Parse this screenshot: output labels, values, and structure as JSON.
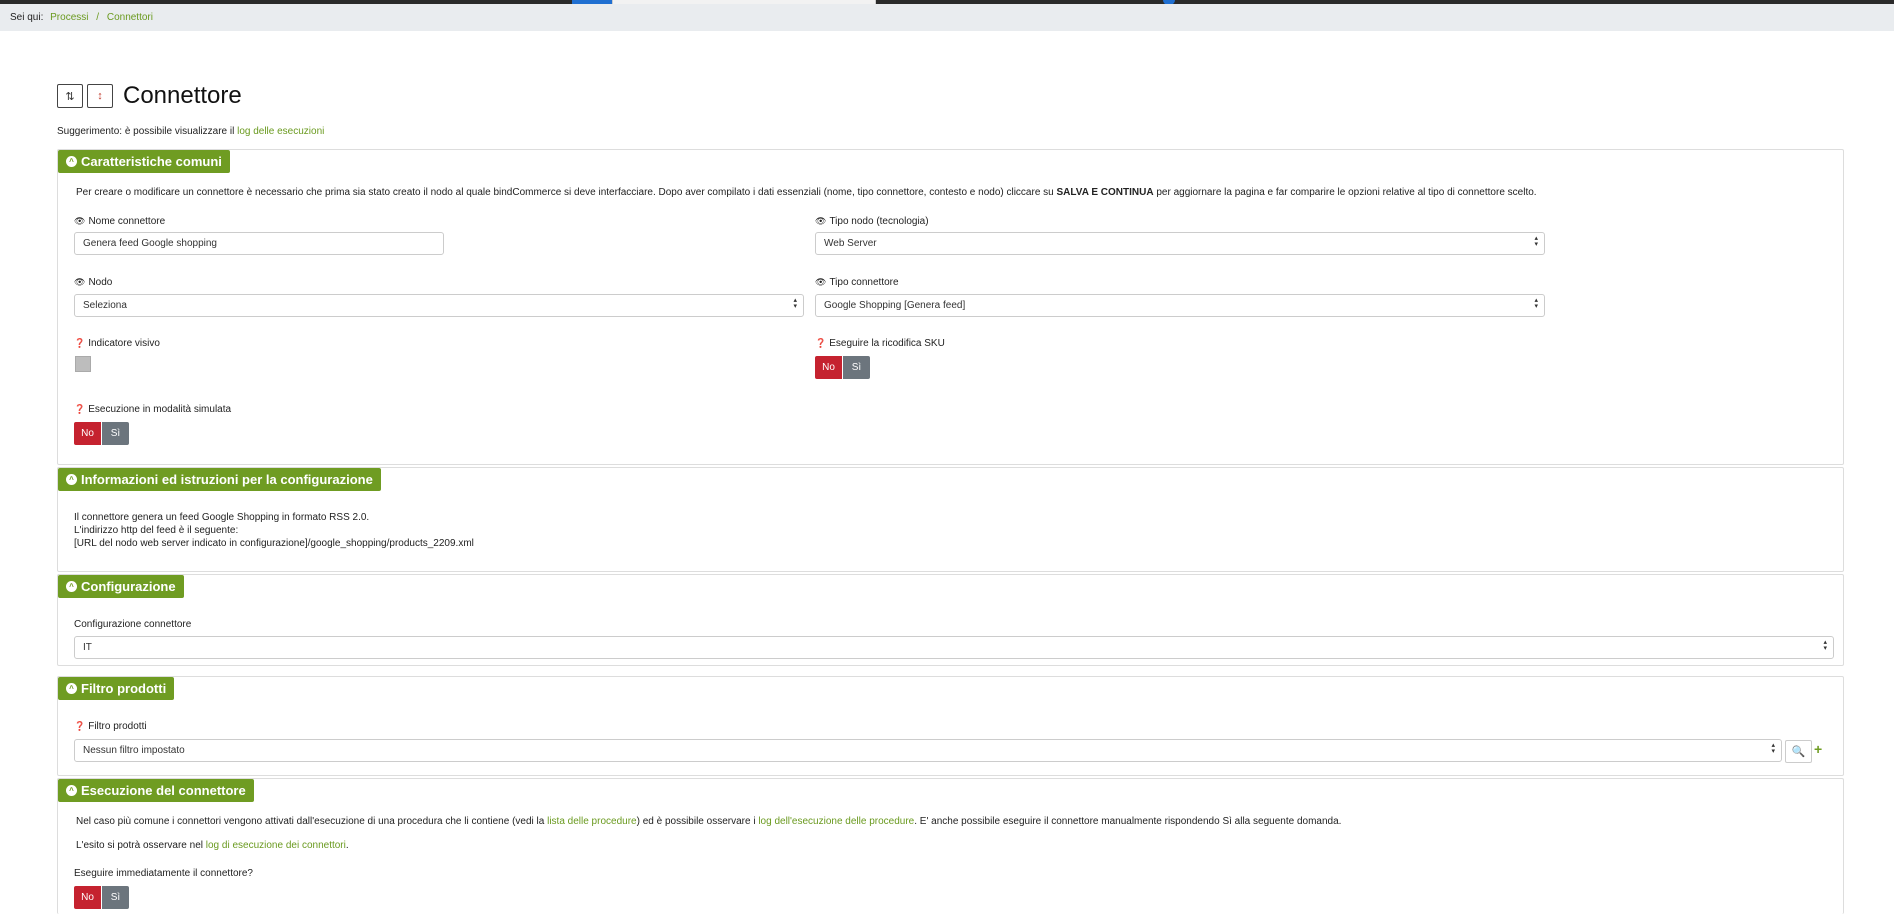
{
  "breadcrumb": {
    "prefix": "Sei qui:",
    "items": [
      "Processi",
      "Connettori"
    ],
    "separator": "/"
  },
  "page": {
    "title": "Connettore",
    "hint_prefix": "Suggerimento: è possibile visualizzare il ",
    "hint_link": "log delle esecuzioni"
  },
  "sections": {
    "common": {
      "title": "Caratteristiche comuni",
      "intro_a": "Per creare o modificare un connettore è necessario che prima sia stato creato il nodo al quale bindCommerce si deve interfacciare. Dopo aver compilato i dati essenziali (nome, tipo connettore, contesto e nodo) cliccare su ",
      "intro_bold": "SALVA E CONTINUA",
      "intro_b": " per aggiornare la pagina e far comparire le opzioni relative al tipo di connettore scelto.",
      "name_label": "Nome connettore",
      "name_value": "Genera feed Google shopping",
      "node_type_label": "Tipo nodo (tecnologia)",
      "node_type_value": "Web Server",
      "node_label": "Nodo",
      "node_value": "Seleziona",
      "connector_type_label": "Tipo connettore",
      "connector_type_value": "Google Shopping [Genera feed]",
      "visual_label": "Indicatore visivo",
      "sku_label": "Eseguire la ricodifica SKU",
      "simulated_label": "Esecuzione in modalità simulata"
    },
    "info": {
      "title": "Informazioni ed istruzioni per la configurazione",
      "line1": "Il connettore genera un feed Google Shopping in formato RSS 2.0.",
      "line2": "L'indirizzo http del feed è il seguente:",
      "line3": "[URL del nodo web server indicato in configurazione]/google_shopping/products_2209.xml"
    },
    "config": {
      "title": "Configurazione",
      "label": "Configurazione connettore",
      "value": "IT"
    },
    "filter": {
      "title": "Filtro prodotti",
      "label": "Filtro prodotti",
      "value": "Nessun filtro impostato",
      "add_symbol": "+"
    },
    "execution": {
      "title": "Esecuzione del connettore",
      "p1_a": "Nel caso più comune i connettori vengono attivati dall'esecuzione di una procedura che li contiene (vedi la ",
      "p1_link1": "lista delle procedure",
      "p1_b": ") ed è possibile osservare i ",
      "p1_link2": "log dell'esecuzione delle procedure",
      "p1_c": ". E' anche possibile eseguire il connettore manualmente rispondendo Sì alla seguente domanda.",
      "p2_a": "L'esito si potrà osservare nel ",
      "p2_link": "log di esecuzione dei connettori",
      "p2_b": ".",
      "question": "Eseguire immediatamente il connettore?"
    }
  },
  "toggle": {
    "no": "No",
    "si": "Sì"
  },
  "colors": {
    "accent": "#6f9c22",
    "no": "#c5222f",
    "si": "#6c757d"
  }
}
